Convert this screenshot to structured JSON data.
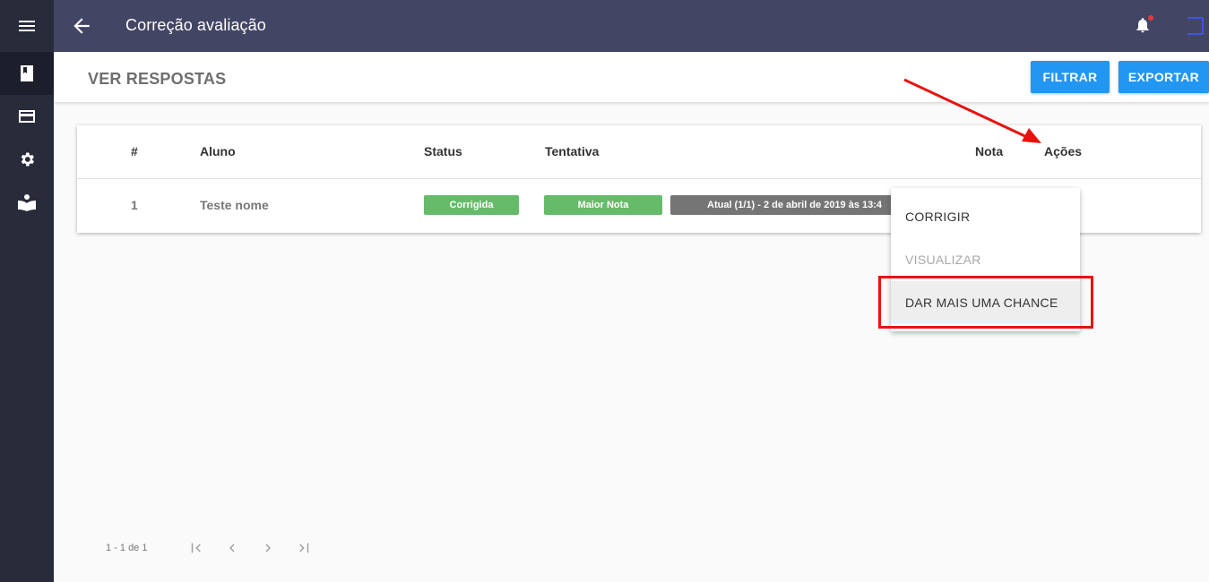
{
  "topbar": {
    "title": "Correção avaliação"
  },
  "header": {
    "title": "VER RESPOSTAS",
    "filter_label": "FILTRAR",
    "export_label": "EXPORTAR"
  },
  "table": {
    "headers": [
      "#",
      "Aluno",
      "Status",
      "Tentativa",
      "Nota",
      "Ações"
    ],
    "rows": [
      {
        "index": "1",
        "student": "Teste nome",
        "status": "Corrigida",
        "attempt_badge": "Maior Nota",
        "attempt_detail": "Atual (1/1) - 2 de abril de 2019 às 13:4"
      }
    ]
  },
  "menu": {
    "items": [
      "CORRIGIR",
      "VISUALIZAR",
      "DAR MAIS UMA CHANCE"
    ]
  },
  "pagination": {
    "range": "1 - 1 de 1"
  },
  "colors": {
    "sidebar": "#272b3a",
    "topbar": "#434565",
    "primary": "#2196f3",
    "success": "#66bb6a",
    "annotation": "#e8130e"
  }
}
